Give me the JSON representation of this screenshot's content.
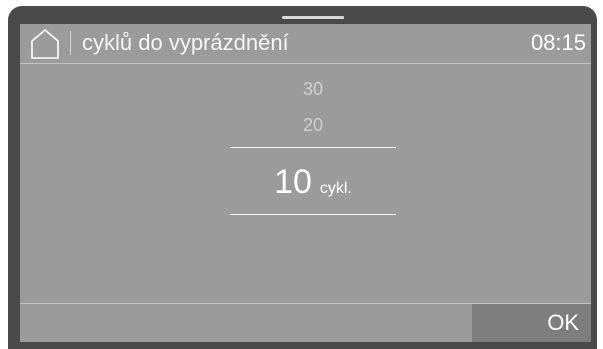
{
  "header": {
    "home_icon": "home-icon",
    "title": "cyklů do vyprázdnění",
    "time": "08:15"
  },
  "picker": {
    "options_above": [
      "30",
      "20"
    ],
    "selected_value": "10",
    "unit": "cykl."
  },
  "footer": {
    "ok_label": "OK"
  },
  "colors": {
    "bezel": "#4a4a4a",
    "screen_background": "#9b9b9b",
    "ok_button_background": "#7e7e7e",
    "text": "#ffffff"
  }
}
